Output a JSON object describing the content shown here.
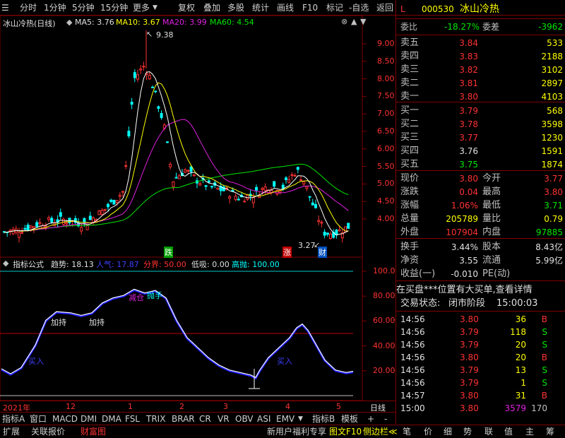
{
  "toolbar": {
    "items": [
      "分时",
      "1分钟",
      "5分钟",
      "15分钟",
      "更多",
      "复权",
      "叠加",
      "多股",
      "统计",
      "画线",
      "F10",
      "标记",
      "-自选",
      "返回"
    ]
  },
  "chart": {
    "title": "冰山冷热(日线)",
    "ma5_label": "MA5: 3.76",
    "ma10_label": "MA10: 3.67",
    "ma20_label": "MA20: 3.99",
    "ma60_label": "MA60: 4.54",
    "high_mark": "9.38",
    "low_mark": "3.27",
    "price_ticks": [
      "9.00",
      "8.50",
      "8.00",
      "7.50",
      "7.00",
      "6.50",
      "6.00",
      "5.50",
      "5.00",
      "4.50",
      "4.00"
    ],
    "event_markers": [
      "跌",
      "涨",
      "财"
    ],
    "colors": {
      "ma5": "#ffffff",
      "ma10": "#ffff00",
      "ma20": "#e020e0",
      "ma60": "#00e600",
      "up": "#ff3232",
      "down": "#00ffff"
    }
  },
  "indicator": {
    "name": "指标公式",
    "trend_label": "趋势: 18.13",
    "pop_label": "人气: 17.87",
    "score_label": "分界: 50.00",
    "low_label": "低吸: 0.00",
    "high_label": "高抛: 100.00",
    "ticks": [
      "100.0",
      "80.00",
      "60.00",
      "40.00",
      "20.00"
    ],
    "annotations": {
      "a1": "加持",
      "a2": "加持",
      "a3": "减仓",
      "a4": "抛手",
      "a5": "买入",
      "a6": "买入"
    }
  },
  "time_axis": {
    "labels": [
      "2021年",
      "12",
      "1",
      "2",
      "3",
      "4",
      "5"
    ],
    "right_label": "日线"
  },
  "tabs": {
    "items": [
      "指标A",
      "窗口",
      "MACD",
      "DMI",
      "DMA",
      "FSL",
      "TRIX",
      "BRAR",
      "CR",
      "VR",
      "OBV",
      "ASI",
      "EMV",
      "指标B",
      "模板",
      "+",
      "-"
    ]
  },
  "status": {
    "left": [
      "扩展",
      "关联报价",
      "财富图"
    ],
    "center": "新用户福利专享",
    "center2": "图文F10",
    "center3": "侧边栏≪",
    "right_tabs": [
      "笔",
      "价",
      "细",
      "势",
      "联",
      "值",
      "主",
      "筹"
    ]
  },
  "quote": {
    "flag": "L",
    "code": "000530",
    "name": "冰山冷热",
    "wb_label": "委比",
    "wb_value": "-18.27%",
    "wc_label": "委差",
    "wc_value": "-3962",
    "asks": [
      {
        "label": "卖五",
        "price": "3.84",
        "vol": "533"
      },
      {
        "label": "卖四",
        "price": "3.83",
        "vol": "2188"
      },
      {
        "label": "卖三",
        "price": "3.82",
        "vol": "3102"
      },
      {
        "label": "卖二",
        "price": "3.81",
        "vol": "2897"
      },
      {
        "label": "卖一",
        "price": "3.80",
        "vol": "4103"
      }
    ],
    "bids": [
      {
        "label": "买一",
        "price": "3.79",
        "vol": "568"
      },
      {
        "label": "买二",
        "price": "3.78",
        "vol": "3598"
      },
      {
        "label": "买三",
        "price": "3.77",
        "vol": "1230"
      },
      {
        "label": "买四",
        "price": "3.76",
        "vol": "1591"
      },
      {
        "label": "买五",
        "price": "3.75",
        "vol": "1874"
      }
    ],
    "stats": [
      {
        "l1": "现价",
        "v1": "3.80",
        "l2": "今开",
        "v2": "3.77"
      },
      {
        "l1": "涨跌",
        "v1": "0.04",
        "l2": "最高",
        "v2": "3.80"
      },
      {
        "l1": "涨幅",
        "v1": "1.06%",
        "l2": "最低",
        "v2": "3.71"
      },
      {
        "l1": "总量",
        "v1": "205789",
        "l2": "量比",
        "v2": "0.79"
      },
      {
        "l1": "外盘",
        "v1": "107904",
        "l2": "内盘",
        "v2": "97885"
      }
    ],
    "fin": [
      {
        "l1": "换手",
        "v1": "3.44%",
        "l2": "股本",
        "v2": "8.43亿"
      },
      {
        "l1": "净资",
        "v1": "3.55",
        "l2": "流通",
        "v2": "5.99亿"
      },
      {
        "l1": "收益(一)",
        "v1": "-0.010",
        "l2": "PE(动)",
        "v2": ""
      }
    ],
    "notice": "在买盘***位置有大买单,查看详情",
    "trade_state_label": "交易状态:",
    "trade_state": "闭市阶段",
    "trade_time": "15:00:03",
    "ticks": [
      {
        "t": "14:56",
        "p": "3.80",
        "v": "36",
        "s": "B"
      },
      {
        "t": "14:56",
        "p": "3.79",
        "v": "118",
        "s": "S"
      },
      {
        "t": "14:56",
        "p": "3.79",
        "v": "20",
        "s": "S"
      },
      {
        "t": "14:56",
        "p": "3.80",
        "v": "20",
        "s": "B"
      },
      {
        "t": "14:56",
        "p": "3.79",
        "v": "13",
        "s": "S"
      },
      {
        "t": "14:56",
        "p": "3.79",
        "v": "1",
        "s": "S"
      },
      {
        "t": "14:57",
        "p": "3.80",
        "v": "31",
        "s": "B"
      },
      {
        "t": "15:00",
        "p": "3.80",
        "v": "3579",
        "s": "170"
      }
    ]
  }
}
